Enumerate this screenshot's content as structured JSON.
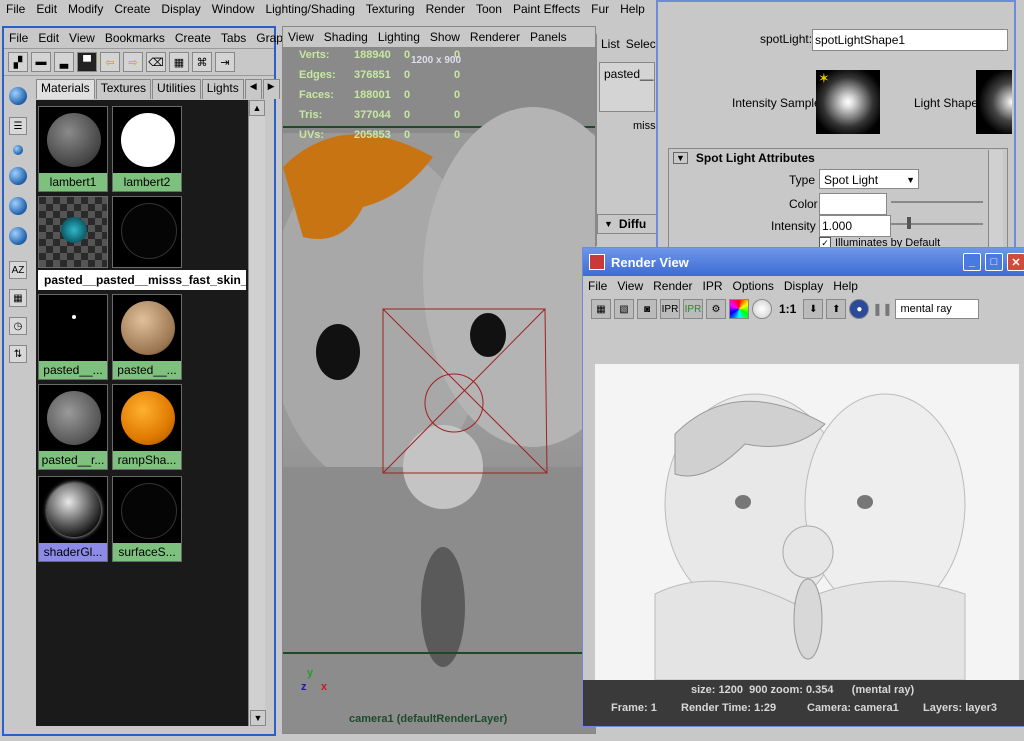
{
  "main_menu": [
    "File",
    "Edit",
    "Modify",
    "Create",
    "Display",
    "Window",
    "Lighting/Shading",
    "Texturing",
    "Render",
    "Toon",
    "Paint Effects",
    "Fur",
    "Help"
  ],
  "hypershade": {
    "menu": [
      "File",
      "Edit",
      "View",
      "Bookmarks",
      "Create",
      "Tabs",
      "Graph"
    ],
    "tabs": [
      "Materials",
      "Textures",
      "Utilities",
      "Lights"
    ],
    "swatches": [
      {
        "label": "lambert1"
      },
      {
        "label": "lambert2"
      },
      {
        "label": "pasted__"
      },
      {
        "label": "pasted__"
      },
      {
        "label": "pasted__..."
      },
      {
        "label": "pasted__..."
      },
      {
        "label": "pasted__r..."
      },
      {
        "label": "rampSha..."
      },
      {
        "label": "shaderGl..."
      },
      {
        "label": "surfaceS..."
      }
    ],
    "selected_name": "pasted__pasted__misss_fast_skin_n"
  },
  "viewport": {
    "menu": [
      "View",
      "Shading",
      "Lighting",
      "Show",
      "Renderer",
      "Panels"
    ],
    "hud": [
      {
        "label": "Verts:",
        "v1": "188940",
        "v2": "0",
        "v3": "0"
      },
      {
        "label": "Edges:",
        "v1": "376851",
        "v2": "0",
        "v3": "0"
      },
      {
        "label": "Faces:",
        "v1": "188001",
        "v2": "0",
        "v3": "0"
      },
      {
        "label": "Tris:",
        "v1": "377044",
        "v2": "0",
        "v3": "0"
      },
      {
        "label": "UVs:",
        "v1": "205853",
        "v2": "0",
        "v3": "0"
      }
    ],
    "resolution": "1200 x 900",
    "camera_label": "camera1 (defaultRenderLayer)",
    "axis_x": "x",
    "axis_y": "y",
    "axis_z": "z"
  },
  "attribute_editor": {
    "name_label": "spotLight:",
    "name_value": "spotLightShape1",
    "intensity_sample": "Intensity Sample",
    "light_shape": "Light Shape",
    "section": "Spot Light Attributes",
    "type_label": "Type",
    "type_value": "Spot Light",
    "color_label": "Color",
    "intensity_label": "Intensity",
    "intensity_value": "1.000",
    "illuminates": "Illuminates by Default"
  },
  "outliner": {
    "menu": [
      "List",
      "Select"
    ],
    "item": "pasted__p",
    "miss": "miss",
    "diffuse": "Diffu"
  },
  "render_view": {
    "title": "Render View",
    "menu": [
      "File",
      "View",
      "Render",
      "IPR",
      "Options",
      "Display",
      "Help"
    ],
    "ratio": "1:1",
    "renderer": "mental ray",
    "status_line1": "size: 1200  900 zoom: 0.354      (mental ray)",
    "frame": "Frame: 1",
    "render_time": "Render Time: 1:29",
    "camera": "Camera: camera1",
    "layers": "Layers: layer3"
  }
}
